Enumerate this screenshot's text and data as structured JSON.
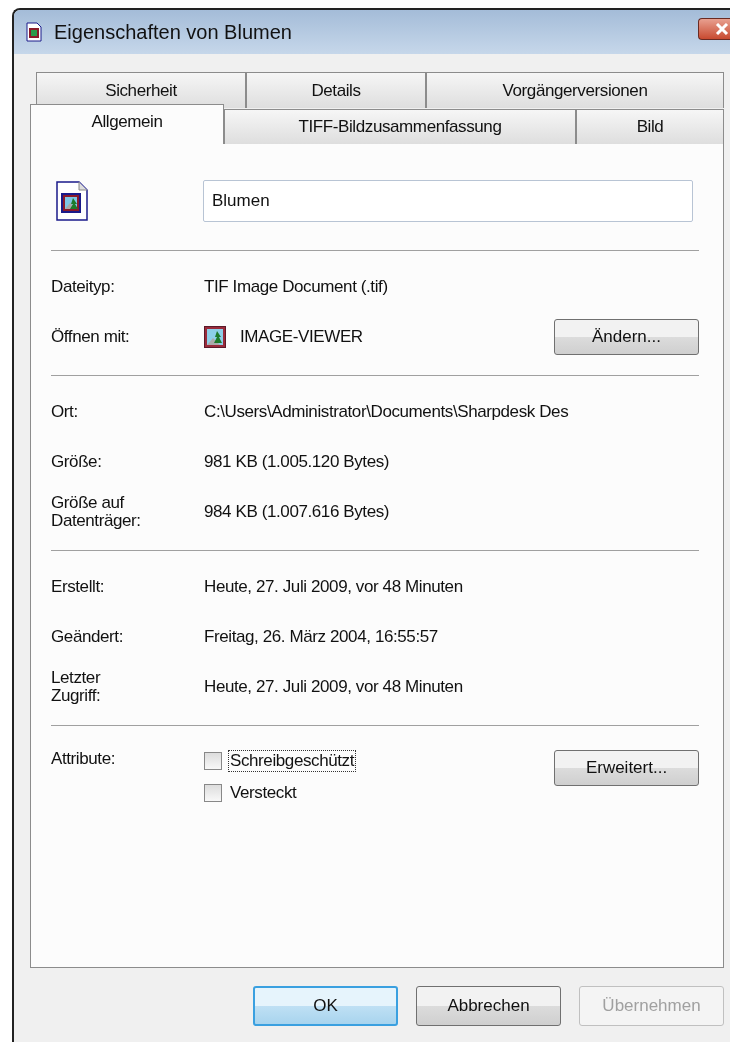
{
  "window": {
    "title": "Eigenschaften von Blumen"
  },
  "tab_rows": [
    {
      "tabs": [
        {
          "label": "Sicherheit",
          "selected": false
        },
        {
          "label": "Details",
          "selected": false
        },
        {
          "label": "Vorgängerversionen",
          "selected": false
        }
      ]
    },
    {
      "tabs": [
        {
          "label": "Allgemein",
          "selected": true
        },
        {
          "label": "TIFF-Bildzusammenfassung",
          "selected": false
        },
        {
          "label": "Bild",
          "selected": false
        }
      ]
    }
  ],
  "file": {
    "name": "Blumen"
  },
  "sections": [
    {
      "rows": [
        {
          "kind": "text",
          "label": "Dateityp:",
          "value": "TIF Image Document (.tif)"
        },
        {
          "kind": "app",
          "label": "Öffnen mit:",
          "value": "IMAGE-VIEWER",
          "button": "Ändern..."
        }
      ]
    },
    {
      "rows": [
        {
          "kind": "text",
          "label": "Ort:",
          "value": "C:\\Users\\Administrator\\Documents\\Sharpdesk Des"
        },
        {
          "kind": "text",
          "label": "Größe:",
          "value": "981 KB (1.005.120 Bytes)"
        },
        {
          "kind": "text",
          "label": "Größe auf\nDatenträger:",
          "value": "984 KB (1.007.616 Bytes)"
        }
      ]
    },
    {
      "rows": [
        {
          "kind": "text",
          "label": "Erstellt:",
          "value": "Heute, 27. Juli 2009, vor 48 Minuten"
        },
        {
          "kind": "text",
          "label": "Geändert:",
          "value": "Freitag, 26. März 2004, 16:55:57"
        },
        {
          "kind": "text",
          "label": "Letzter\nZugriff:",
          "value": "Heute, 27. Juli 2009, vor 48 Minuten"
        }
      ]
    },
    {
      "rows": [
        {
          "kind": "checks",
          "label": "Attribute:",
          "button": "Erweitert...",
          "checks": [
            {
              "label": "Schreibgeschützt",
              "checked": false,
              "focused": true
            },
            {
              "label": "Versteckt",
              "checked": false,
              "focused": false
            }
          ]
        }
      ]
    }
  ],
  "buttons": [
    {
      "label": "OK",
      "default": true,
      "disabled": false
    },
    {
      "label": "Abbrechen",
      "default": false,
      "disabled": false
    },
    {
      "label": "Übernehmen",
      "default": false,
      "disabled": true
    }
  ]
}
